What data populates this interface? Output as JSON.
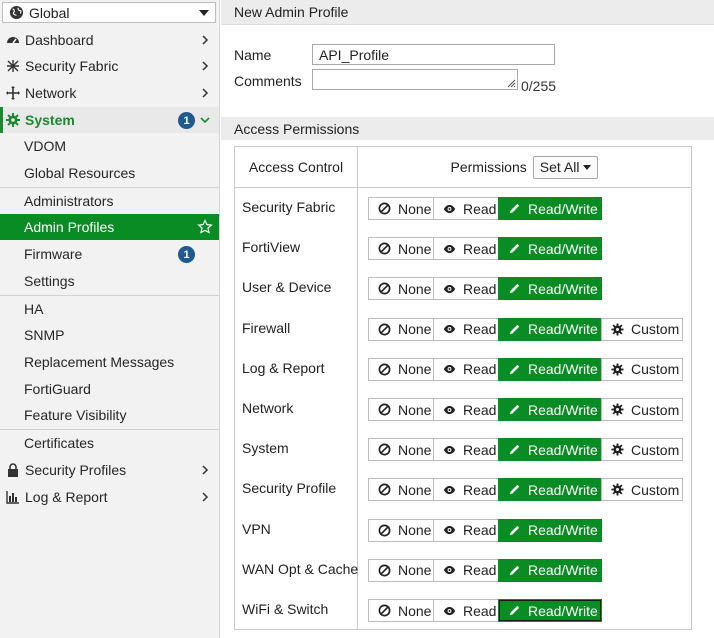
{
  "sidebar": {
    "vdom": "Global",
    "items": [
      {
        "label": "Dashboard"
      },
      {
        "label": "Security Fabric"
      },
      {
        "label": "Network"
      },
      {
        "label": "System",
        "badge": "1"
      },
      {
        "label": "VDOM"
      },
      {
        "label": "Global Resources"
      },
      {
        "label": "Administrators"
      },
      {
        "label": "Admin Profiles"
      },
      {
        "label": "Firmware",
        "badge": "1"
      },
      {
        "label": "Settings"
      },
      {
        "label": "HA"
      },
      {
        "label": "SNMP"
      },
      {
        "label": "Replacement Messages"
      },
      {
        "label": "FortiGuard"
      },
      {
        "label": "Feature Visibility"
      },
      {
        "label": "Certificates"
      },
      {
        "label": "Security Profiles"
      },
      {
        "label": "Log & Report"
      }
    ]
  },
  "main": {
    "title": "New Admin Profile",
    "name_label": "Name",
    "name_value": "API_Profile",
    "comments_label": "Comments",
    "comments_counter": "0/255",
    "section_title": "Access Permissions",
    "table": {
      "col_access": "Access Control",
      "col_permissions": "Permissions",
      "set_all": "Set All",
      "btn_none": "None",
      "btn_read": "Read",
      "btn_readwrite": "Read/Write",
      "btn_custom": "Custom",
      "rows": [
        {
          "label": "Security Fabric",
          "selected": "Read/Write",
          "custom": false
        },
        {
          "label": "FortiView",
          "selected": "Read/Write",
          "custom": false
        },
        {
          "label": "User & Device",
          "selected": "Read/Write",
          "custom": false
        },
        {
          "label": "Firewall",
          "selected": "Read/Write",
          "custom": true
        },
        {
          "label": "Log & Report",
          "selected": "Read/Write",
          "custom": true
        },
        {
          "label": "Network",
          "selected": "Read/Write",
          "custom": true
        },
        {
          "label": "System",
          "selected": "Read/Write",
          "custom": true
        },
        {
          "label": "Security Profile",
          "selected": "Read/Write",
          "custom": true
        },
        {
          "label": "VPN",
          "selected": "Read/Write",
          "custom": false
        },
        {
          "label": "WAN Opt & Cache",
          "selected": "Read/Write",
          "custom": false
        },
        {
          "label": "WiFi & Switch",
          "selected": "Read/Write",
          "custom": false
        }
      ]
    }
  },
  "colors": {
    "accent_green": "#0a8c24",
    "system_green": "#1a8a2e",
    "badge_blue": "#1e5a8e"
  }
}
